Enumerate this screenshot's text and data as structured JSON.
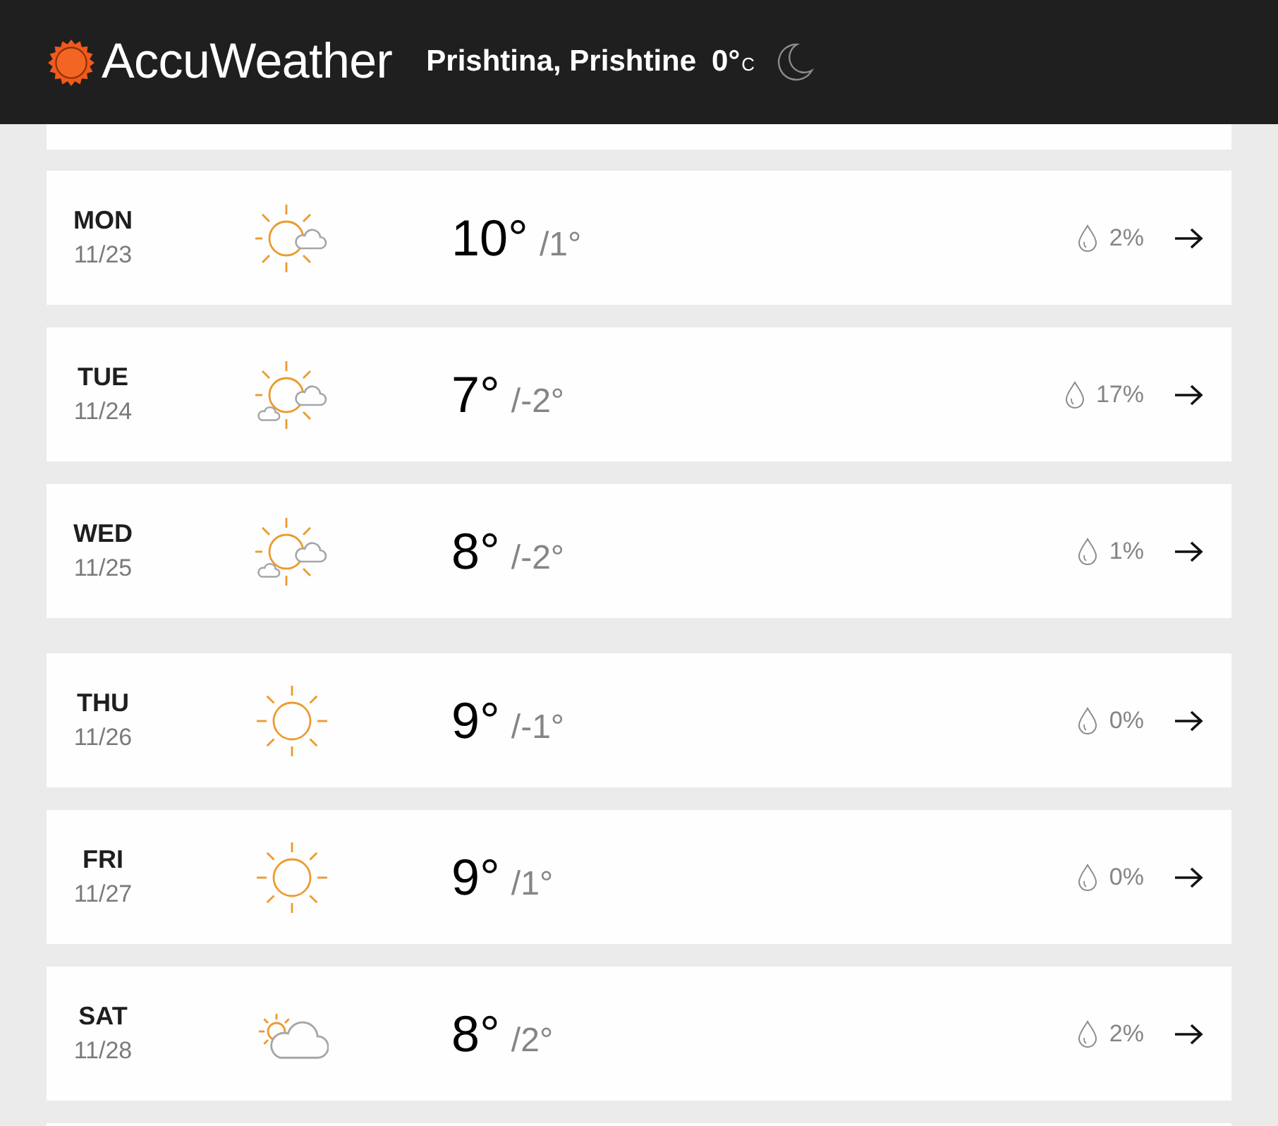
{
  "header": {
    "logo_text": "AccuWeather",
    "location": "Prishtina, Prishtine",
    "temperature": "0°",
    "unit": "C"
  },
  "days": [
    {
      "kind": "sun_cloud",
      "day": "MON",
      "date": "11/23",
      "high": "10°",
      "low": "/1°",
      "precip": "2%"
    },
    {
      "kind": "sun_clouds",
      "day": "TUE",
      "date": "11/24",
      "high": "7°",
      "low": "/-2°",
      "precip": "17%"
    },
    {
      "kind": "sun_clouds",
      "day": "WED",
      "date": "11/25",
      "high": "8°",
      "low": "/-2°",
      "precip": "1%"
    },
    {
      "kind": "sun",
      "day": "THU",
      "date": "11/26",
      "high": "9°",
      "low": "/-1°",
      "precip": "0%"
    },
    {
      "kind": "sun",
      "day": "FRI",
      "date": "11/27",
      "high": "9°",
      "low": "/1°",
      "precip": "0%"
    },
    {
      "kind": "cloud_sun",
      "day": "SAT",
      "date": "11/28",
      "high": "8°",
      "low": "/2°",
      "precip": "2%"
    }
  ]
}
